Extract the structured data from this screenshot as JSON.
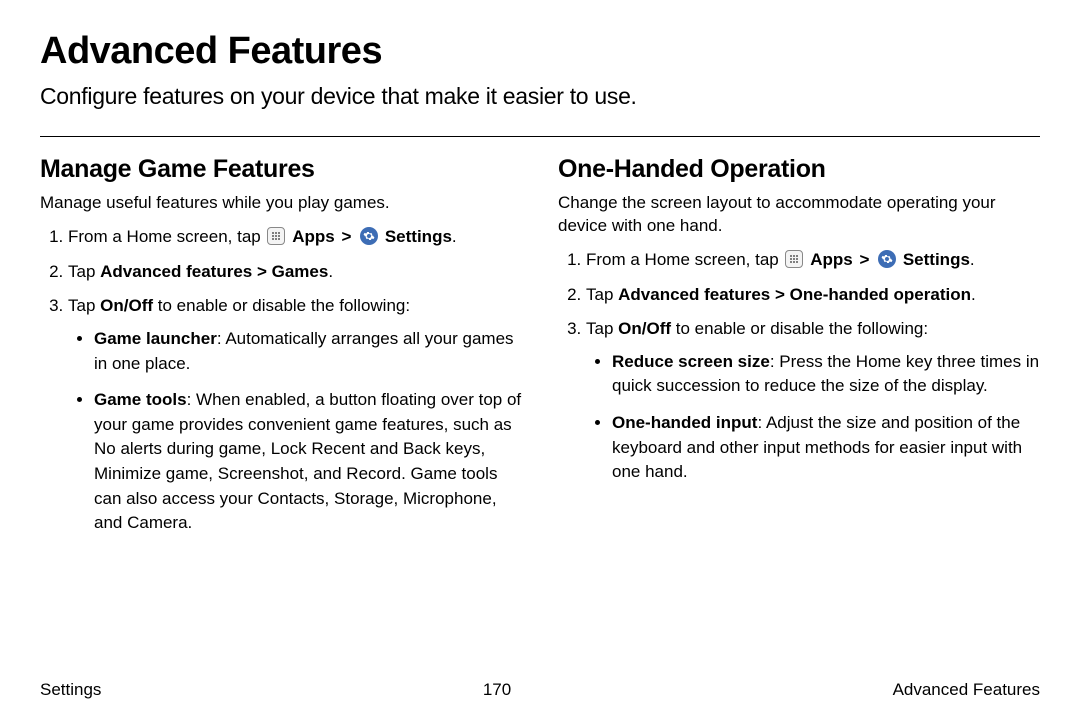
{
  "title": "Advanced Features",
  "subtitle": "Configure features on your device that make it easier to use.",
  "left": {
    "heading": "Manage Game Features",
    "intro": "Manage useful features while you play games.",
    "step1_prefix": "From a Home screen, tap ",
    "apps_label": "Apps",
    "settings_label": "Settings",
    "step2_prefix": "Tap ",
    "step2_bold": "Advanced features > Games",
    "step3_prefix": "Tap ",
    "step3_bold": "On/Off",
    "step3_suffix": " to enable or disable the following:",
    "bullets": [
      {
        "title": "Game launcher",
        "text": ": Automatically arranges all your games in one place."
      },
      {
        "title": "Game tools",
        "text": ": When enabled, a button floating over top of your game provides convenient game features, such as No alerts during game, Lock Recent and Back keys, Minimize game, Screenshot, and Record. Game tools can also access your Contacts, Storage, Microphone, and Camera."
      }
    ]
  },
  "right": {
    "heading": "One-Handed Operation",
    "intro": "Change the screen layout to accommodate operating your device with one hand.",
    "step1_prefix": "From a Home screen, tap ",
    "apps_label": "Apps",
    "settings_label": "Settings",
    "step2_prefix": "Tap ",
    "step2_bold": "Advanced features > One-handed operation",
    "step3_prefix": "Tap ",
    "step3_bold": "On/Off",
    "step3_suffix": " to enable or disable the following:",
    "bullets": [
      {
        "title": "Reduce screen size",
        "text": ": Press the Home key three times in quick succession to reduce the size of the display."
      },
      {
        "title": "One-handed input",
        "text": ": Adjust the size and position of the keyboard and other input methods for easier input with one hand."
      }
    ]
  },
  "footer": {
    "left": "Settings",
    "center": "170",
    "right": "Advanced Features"
  },
  "chevron": ">"
}
